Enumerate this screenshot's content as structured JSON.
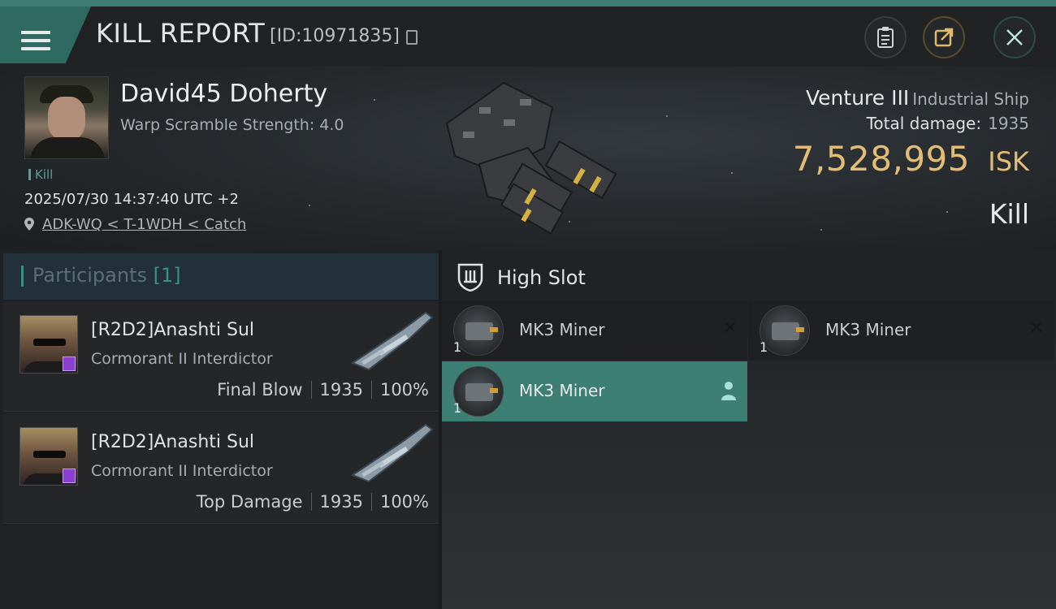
{
  "header": {
    "title": "KILL REPORT",
    "report_id": "[ID:10971835]"
  },
  "victim": {
    "name": "David45 Doherty",
    "warp_scramble": "Warp Scramble Strength: 4.0",
    "tag": "Kill",
    "timestamp": "2025/07/30 14:37:40 UTC +2",
    "location": "ADK-WQ < T-1WDH < Catch"
  },
  "ship": {
    "name": "Venture III",
    "class": "Industrial Ship",
    "total_damage_label": "Total damage:",
    "total_damage_value": "1935",
    "isk_value": "7,528,995",
    "isk_unit": "ISK",
    "result": "Kill"
  },
  "participants": {
    "title": "Participants",
    "count": "[1]",
    "rows": [
      {
        "name": "[R2D2]Anashti Sul",
        "ship": "Cormorant II Interdictor",
        "role": "Final Blow",
        "damage": "1935",
        "percent": "100%"
      },
      {
        "name": "[R2D2]Anashti Sul",
        "ship": "Cormorant II Interdictor",
        "role": "Top Damage",
        "damage": "1935",
        "percent": "100%"
      }
    ]
  },
  "slots": {
    "title": "High Slot",
    "modules": [
      {
        "name": "MK3 Miner",
        "qty": "1",
        "state": "destroyed"
      },
      {
        "name": "MK3 Miner",
        "qty": "1",
        "state": "destroyed"
      },
      {
        "name": "MK3 Miner",
        "qty": "1",
        "state": "dropped"
      }
    ]
  },
  "colors": {
    "accent": "#3f7d73",
    "isk": "#e1bd76",
    "selected_slot": "#3e7f74",
    "badge": "#8b3fd1"
  },
  "icons": [
    "menu-icon",
    "copy-icon",
    "clipboard-icon",
    "share-icon",
    "close-icon",
    "location-pin-icon",
    "high-slot-icon",
    "destroyed-x-icon",
    "person-icon"
  ]
}
